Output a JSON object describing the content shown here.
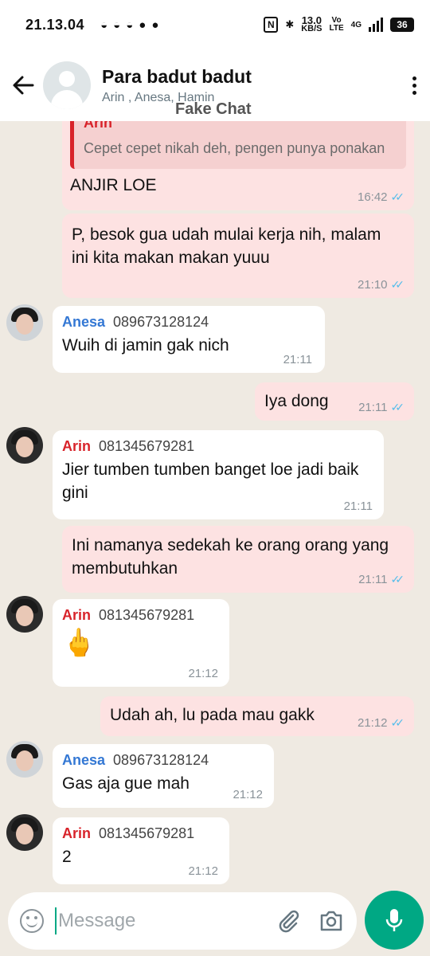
{
  "status": {
    "time": "21.13.04",
    "speed_value": "13.0",
    "speed_unit": "KB/S",
    "volte_top": "Vo",
    "volte_bottom": "LTE",
    "network": "4G",
    "battery": "36"
  },
  "header": {
    "title": "Para badut badut",
    "subtitle": "Arin , Anesa, Hamin",
    "watermark": "Fake Chat"
  },
  "messages": [
    {
      "dir": "out",
      "quote_name": "Arin",
      "quote_text": "Cepet cepet nikah deh, pengen punya ponakan",
      "text": "ANJIR LOE",
      "time": "16:42"
    },
    {
      "dir": "out",
      "text": "P, besok gua udah mulai kerja nih, malam ini kita makan makan yuuu",
      "time": "21:10"
    },
    {
      "dir": "in",
      "sender": "Anesa",
      "phone": "089673128124",
      "text": "Wuih di jamin gak nich",
      "time": "21:11"
    },
    {
      "dir": "out",
      "text": "Iya dong",
      "time": "21:11"
    },
    {
      "dir": "in",
      "sender": "Arin",
      "phone": "081345679281",
      "text": "Jier tumben tumben banget loe jadi baik gini",
      "time": "21:11"
    },
    {
      "dir": "out",
      "text": "Ini namanya sedekah ke orang orang yang membutuhkan",
      "time": "21:11"
    },
    {
      "dir": "in",
      "sender": "Arin",
      "phone": "081345679281",
      "text": "🖕",
      "time": "21:12"
    },
    {
      "dir": "out",
      "text": "Udah ah, lu pada mau gakk",
      "time": "21:12"
    },
    {
      "dir": "in",
      "sender": "Anesa",
      "phone": "089673128124",
      "text": "Gas aja gue mah",
      "time": "21:12"
    },
    {
      "dir": "in",
      "sender": "Arin",
      "phone": "081345679281",
      "text": "2",
      "time": "21:12"
    }
  ],
  "input": {
    "placeholder": "Message"
  },
  "colors": {
    "accent": "#00a884",
    "outgoing_bubble": "#fde2e2",
    "incoming_bubble": "#ffffff",
    "chat_bg": "#efeae2",
    "read_ticks": "#53bdeb",
    "arin_name": "#d8232a",
    "anesa_name": "#3478d4"
  },
  "icons": [
    "back-arrow-icon",
    "group-avatar-icon",
    "more-vert-icon",
    "double-check-icon",
    "emoji-icon",
    "attach-icon",
    "camera-icon",
    "mic-icon"
  ]
}
